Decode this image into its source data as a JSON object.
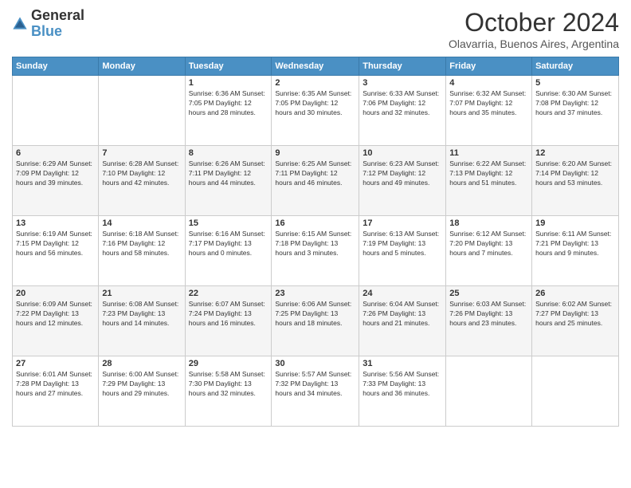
{
  "logo": {
    "general": "General",
    "blue": "Blue"
  },
  "header": {
    "month": "October 2024",
    "location": "Olavarria, Buenos Aires, Argentina"
  },
  "weekdays": [
    "Sunday",
    "Monday",
    "Tuesday",
    "Wednesday",
    "Thursday",
    "Friday",
    "Saturday"
  ],
  "weeks": [
    [
      {
        "day": "",
        "info": ""
      },
      {
        "day": "",
        "info": ""
      },
      {
        "day": "1",
        "info": "Sunrise: 6:36 AM\nSunset: 7:05 PM\nDaylight: 12 hours and 28 minutes."
      },
      {
        "day": "2",
        "info": "Sunrise: 6:35 AM\nSunset: 7:05 PM\nDaylight: 12 hours and 30 minutes."
      },
      {
        "day": "3",
        "info": "Sunrise: 6:33 AM\nSunset: 7:06 PM\nDaylight: 12 hours and 32 minutes."
      },
      {
        "day": "4",
        "info": "Sunrise: 6:32 AM\nSunset: 7:07 PM\nDaylight: 12 hours and 35 minutes."
      },
      {
        "day": "5",
        "info": "Sunrise: 6:30 AM\nSunset: 7:08 PM\nDaylight: 12 hours and 37 minutes."
      }
    ],
    [
      {
        "day": "6",
        "info": "Sunrise: 6:29 AM\nSunset: 7:09 PM\nDaylight: 12 hours and 39 minutes."
      },
      {
        "day": "7",
        "info": "Sunrise: 6:28 AM\nSunset: 7:10 PM\nDaylight: 12 hours and 42 minutes."
      },
      {
        "day": "8",
        "info": "Sunrise: 6:26 AM\nSunset: 7:11 PM\nDaylight: 12 hours and 44 minutes."
      },
      {
        "day": "9",
        "info": "Sunrise: 6:25 AM\nSunset: 7:11 PM\nDaylight: 12 hours and 46 minutes."
      },
      {
        "day": "10",
        "info": "Sunrise: 6:23 AM\nSunset: 7:12 PM\nDaylight: 12 hours and 49 minutes."
      },
      {
        "day": "11",
        "info": "Sunrise: 6:22 AM\nSunset: 7:13 PM\nDaylight: 12 hours and 51 minutes."
      },
      {
        "day": "12",
        "info": "Sunrise: 6:20 AM\nSunset: 7:14 PM\nDaylight: 12 hours and 53 minutes."
      }
    ],
    [
      {
        "day": "13",
        "info": "Sunrise: 6:19 AM\nSunset: 7:15 PM\nDaylight: 12 hours and 56 minutes."
      },
      {
        "day": "14",
        "info": "Sunrise: 6:18 AM\nSunset: 7:16 PM\nDaylight: 12 hours and 58 minutes."
      },
      {
        "day": "15",
        "info": "Sunrise: 6:16 AM\nSunset: 7:17 PM\nDaylight: 13 hours and 0 minutes."
      },
      {
        "day": "16",
        "info": "Sunrise: 6:15 AM\nSunset: 7:18 PM\nDaylight: 13 hours and 3 minutes."
      },
      {
        "day": "17",
        "info": "Sunrise: 6:13 AM\nSunset: 7:19 PM\nDaylight: 13 hours and 5 minutes."
      },
      {
        "day": "18",
        "info": "Sunrise: 6:12 AM\nSunset: 7:20 PM\nDaylight: 13 hours and 7 minutes."
      },
      {
        "day": "19",
        "info": "Sunrise: 6:11 AM\nSunset: 7:21 PM\nDaylight: 13 hours and 9 minutes."
      }
    ],
    [
      {
        "day": "20",
        "info": "Sunrise: 6:09 AM\nSunset: 7:22 PM\nDaylight: 13 hours and 12 minutes."
      },
      {
        "day": "21",
        "info": "Sunrise: 6:08 AM\nSunset: 7:23 PM\nDaylight: 13 hours and 14 minutes."
      },
      {
        "day": "22",
        "info": "Sunrise: 6:07 AM\nSunset: 7:24 PM\nDaylight: 13 hours and 16 minutes."
      },
      {
        "day": "23",
        "info": "Sunrise: 6:06 AM\nSunset: 7:25 PM\nDaylight: 13 hours and 18 minutes."
      },
      {
        "day": "24",
        "info": "Sunrise: 6:04 AM\nSunset: 7:26 PM\nDaylight: 13 hours and 21 minutes."
      },
      {
        "day": "25",
        "info": "Sunrise: 6:03 AM\nSunset: 7:26 PM\nDaylight: 13 hours and 23 minutes."
      },
      {
        "day": "26",
        "info": "Sunrise: 6:02 AM\nSunset: 7:27 PM\nDaylight: 13 hours and 25 minutes."
      }
    ],
    [
      {
        "day": "27",
        "info": "Sunrise: 6:01 AM\nSunset: 7:28 PM\nDaylight: 13 hours and 27 minutes."
      },
      {
        "day": "28",
        "info": "Sunrise: 6:00 AM\nSunset: 7:29 PM\nDaylight: 13 hours and 29 minutes."
      },
      {
        "day": "29",
        "info": "Sunrise: 5:58 AM\nSunset: 7:30 PM\nDaylight: 13 hours and 32 minutes."
      },
      {
        "day": "30",
        "info": "Sunrise: 5:57 AM\nSunset: 7:32 PM\nDaylight: 13 hours and 34 minutes."
      },
      {
        "day": "31",
        "info": "Sunrise: 5:56 AM\nSunset: 7:33 PM\nDaylight: 13 hours and 36 minutes."
      },
      {
        "day": "",
        "info": ""
      },
      {
        "day": "",
        "info": ""
      }
    ]
  ]
}
